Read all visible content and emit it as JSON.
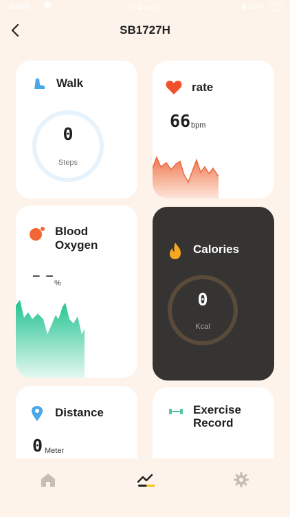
{
  "status_bar": {
    "carrier": "Sketch",
    "time": "下午4:03",
    "battery": "56%"
  },
  "header": {
    "title": "SB1727H"
  },
  "cards": {
    "walk": {
      "title": "Walk",
      "value": "0",
      "unit": "Steps"
    },
    "rate": {
      "title": "rate",
      "value": "66",
      "unit": "bpm"
    },
    "blood_oxygen": {
      "title_line1": "Blood",
      "title_line2": "Oxygen",
      "value": "— —",
      "unit": "%"
    },
    "calories": {
      "title": "Calories",
      "value": "0",
      "unit": "Kcal"
    },
    "distance": {
      "title": "Distance",
      "value": "0",
      "unit": "Meter"
    },
    "exercise": {
      "title_line1": "Exercise",
      "title_line2": "Record"
    }
  },
  "tabbar": {
    "tabs": [
      "home-icon",
      "trend-icon",
      "gear-icon"
    ],
    "active": "trend-icon"
  },
  "colors": {
    "background": "#FEF3EA",
    "walk_accent": "#4AA8E8",
    "rate_accent": "#F0502A",
    "oxygen_accent": "#2FCB98",
    "calories_card": "#363433",
    "calories_ring": "#5A4A3A"
  }
}
